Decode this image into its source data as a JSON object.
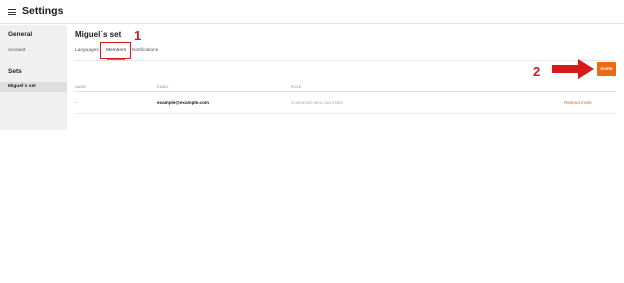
{
  "header": {
    "title": "Settings",
    "menu_icon": "hamburger-menu-icon"
  },
  "sidebar": {
    "general_heading": "General",
    "account_item": "Account",
    "sets_heading": "Sets",
    "active_set": "Miguel´s set"
  },
  "main": {
    "title": "Miguel´s set",
    "tabs": [
      {
        "label": "Languages"
      },
      {
        "label": "Members",
        "active": true
      },
      {
        "label": "Notifications"
      }
    ],
    "invite_label": "Invite",
    "table": {
      "columns": [
        "NAME",
        "EMAIL",
        "ROLE"
      ],
      "rows": [
        {
          "name": "-",
          "email": "example@example.com",
          "role_placeholder": "Customize who can invite",
          "action": "Resend invite"
        }
      ]
    }
  },
  "annotations": {
    "step1": "1",
    "step2": "2"
  },
  "colors": {
    "accent": "#ec6a0d",
    "annotation": "#d91a1a"
  }
}
